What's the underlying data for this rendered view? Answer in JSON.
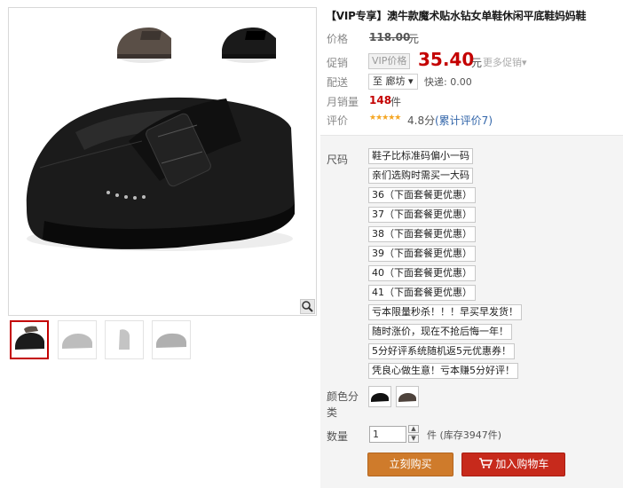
{
  "product": {
    "title": "【VIP专享】澳牛款魔术贴水钻女单鞋休闲平底鞋妈妈鞋"
  },
  "price": {
    "label": "价格",
    "original": "118.00",
    "unit": "元"
  },
  "promo": {
    "label": "促销",
    "vip_tag": "VIP价格",
    "price": "35.40",
    "unit": "元",
    "more": "更多促销"
  },
  "shipping": {
    "label": "配送",
    "destination": "至 廊坊",
    "rest": "快递: 0.00"
  },
  "sales": {
    "label": "月销量",
    "count": "148",
    "unit": "件"
  },
  "rating": {
    "label": "评价",
    "stars": "★★★★★",
    "score": "4.8分",
    "link": "(累计评价7)"
  },
  "size": {
    "label": "尺码",
    "options": [
      "鞋子比标准码偏小一码",
      "亲们选购时需买一大码",
      "36（下面套餐更优惠）",
      "37（下面套餐更优惠）",
      "38（下面套餐更优惠）",
      "39（下面套餐更优惠）",
      "40（下面套餐更优惠）",
      "41（下面套餐更优惠）",
      "亏本限量秒杀！！！早买早发货！",
      "随时涨价，现在不抢后悔一年！",
      "5分好评系统随机返5元优惠券！",
      "凭良心做生意！亏本赚5分好评！"
    ]
  },
  "color": {
    "label": "颜色分类"
  },
  "quantity": {
    "label": "数量",
    "value": "1",
    "stock": "件 (库存3947件)"
  },
  "actions": {
    "buy_now": "立刻购买",
    "add_to_cart": "加入购物车"
  },
  "colors": {
    "price_red": "#c40000",
    "buy_orange": "#cf7b2b",
    "cart_red": "#c72a1c"
  }
}
